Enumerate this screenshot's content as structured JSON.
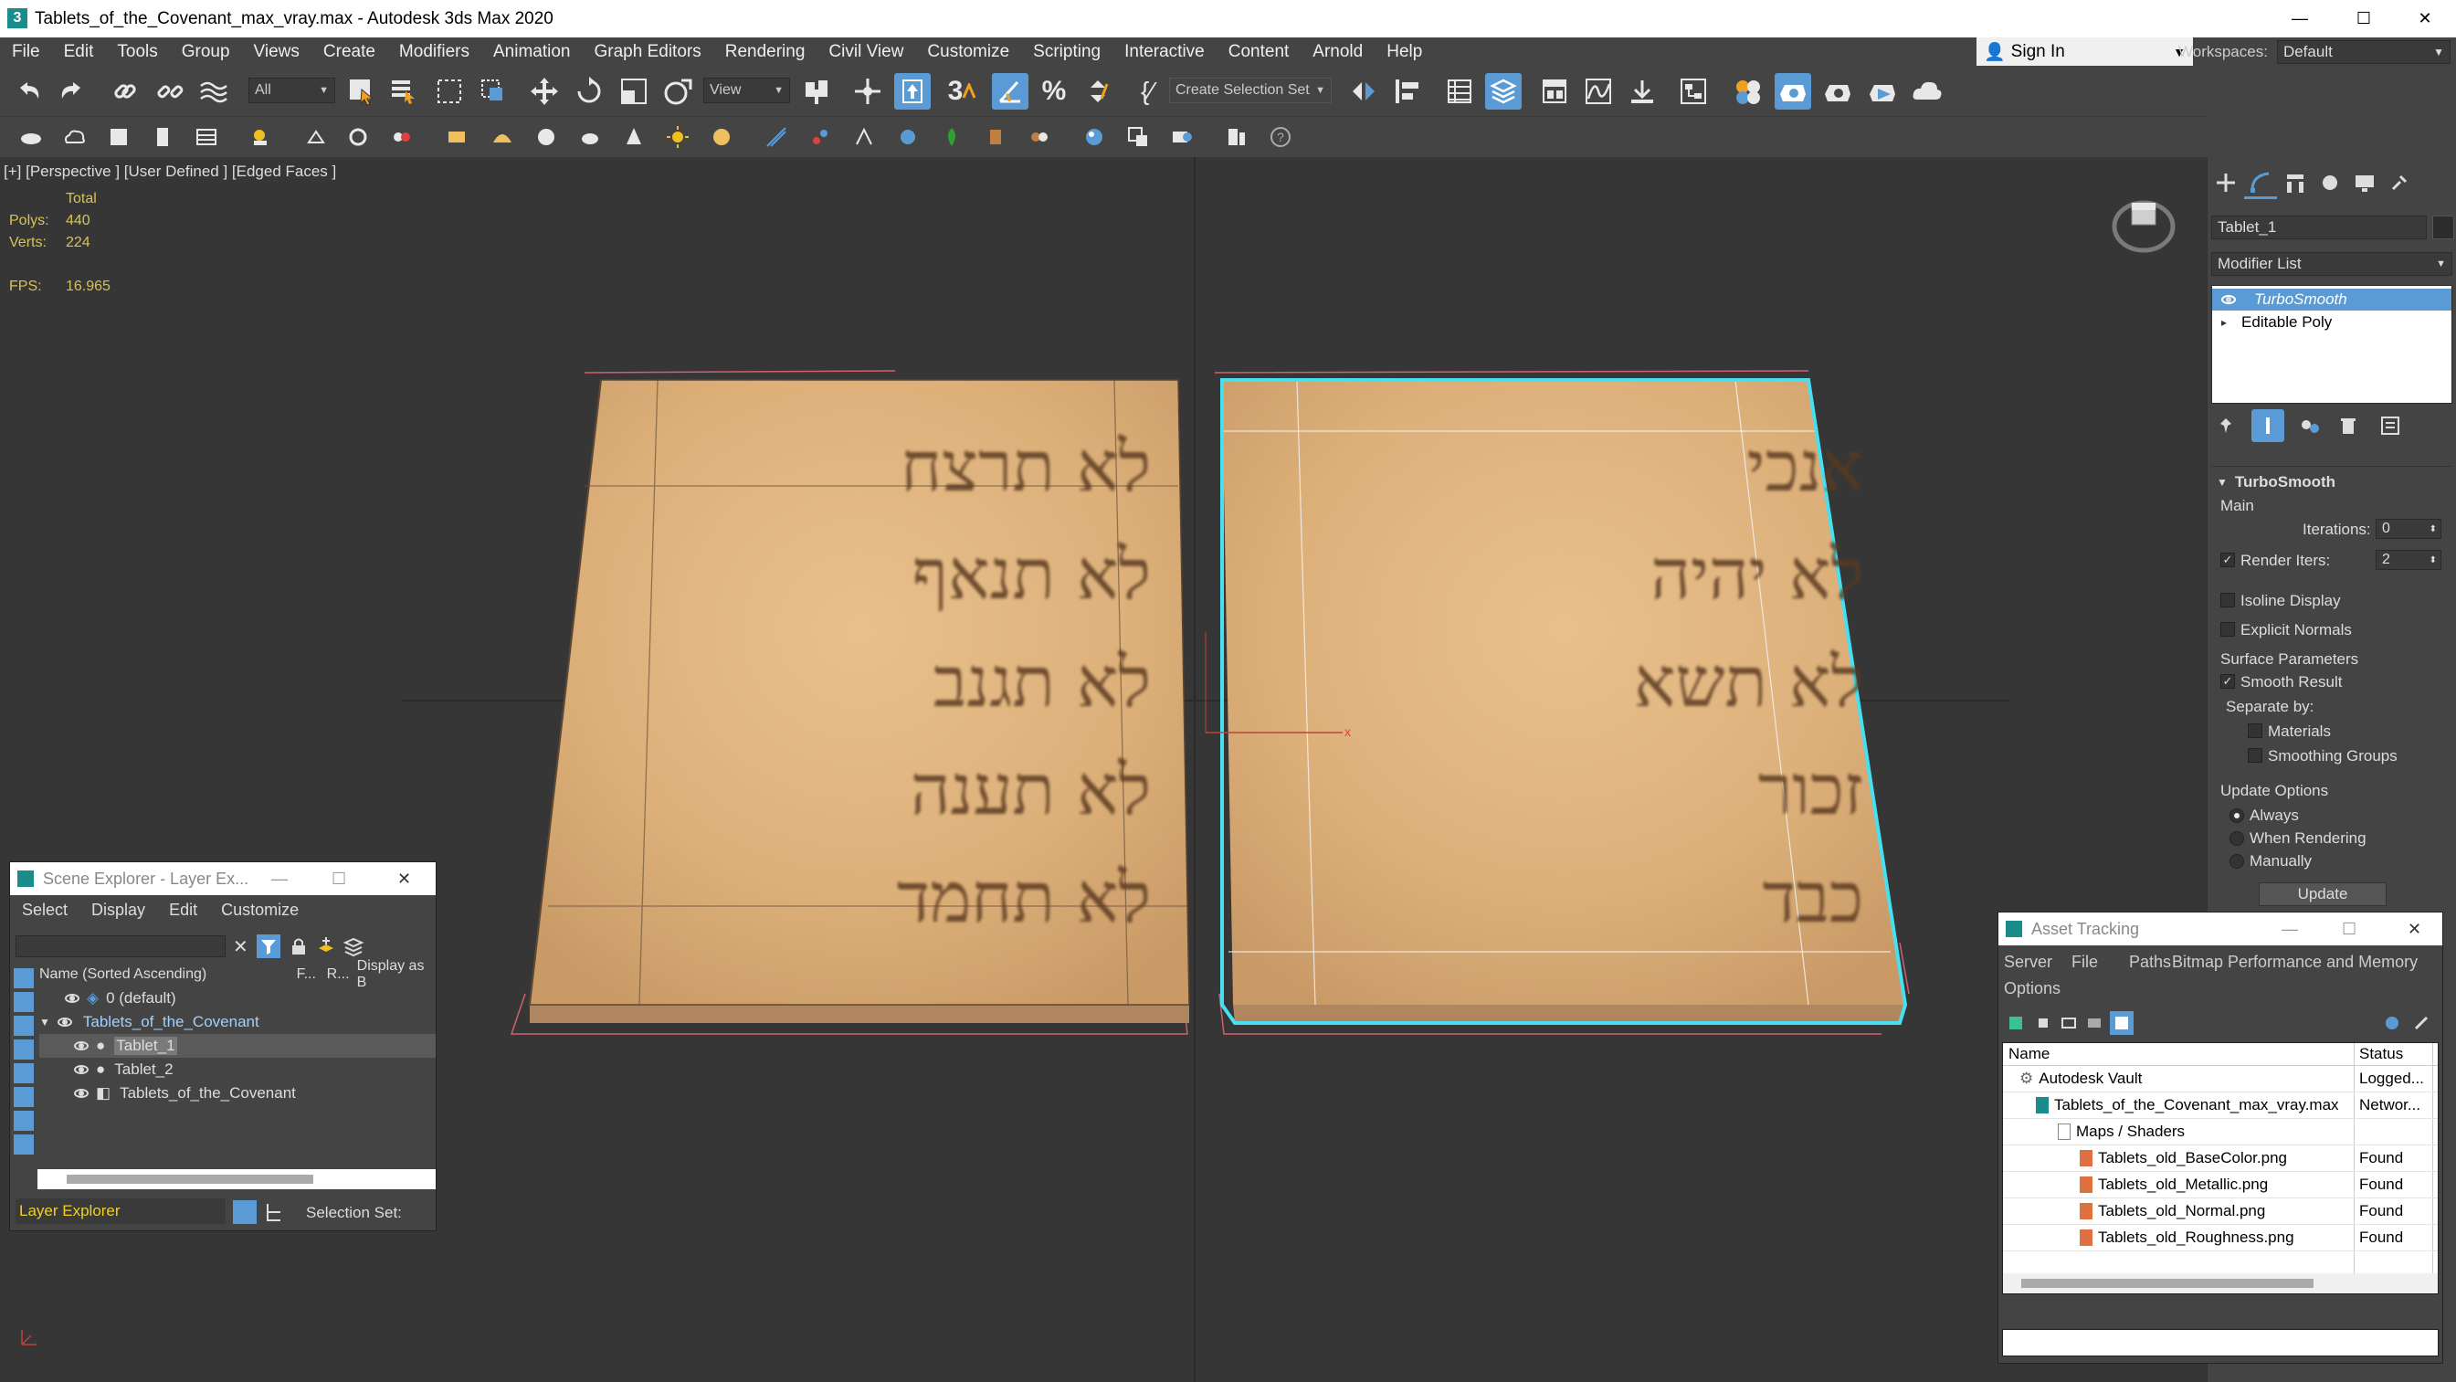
{
  "window": {
    "title": "Tablets_of_the_Covenant_max_vray.max - Autodesk 3ds Max 2020",
    "minimize": "—",
    "maximize": "☐",
    "close": "✕"
  },
  "menu": [
    "File",
    "Edit",
    "Tools",
    "Group",
    "Views",
    "Create",
    "Modifiers",
    "Animation",
    "Graph Editors",
    "Rendering",
    "Civil View",
    "Customize",
    "Scripting",
    "Interactive",
    "Content",
    "Arnold",
    "Help"
  ],
  "account": {
    "sign_in": "Sign In",
    "workspaces_label": "Workspaces:",
    "workspace": "Default"
  },
  "toolbar": {
    "selection_filter": "All",
    "ref_coord": "View",
    "snap_angle_label": "3",
    "named_selection": "Create Selection Set"
  },
  "viewport": {
    "label": "[+] [Perspective ] [User Defined ] [Edged Faces ]",
    "stats_total": "Total",
    "polys_label": "Polys:",
    "polys_value": "440",
    "verts_label": "Verts:",
    "verts_value": "224",
    "fps_label": "FPS:",
    "fps_value": "16.965"
  },
  "tablets": {
    "left_lines": [
      "לא תרצח",
      "לא תנאף",
      "לא תגנב",
      "לא תענה",
      "לא תחמד"
    ],
    "right_lines": [
      "אנכי",
      "לא יהיה",
      "לא תשא",
      "זכור",
      "כבד"
    ]
  },
  "command_panel": {
    "object_name": "Tablet_1",
    "modifier_list": "Modifier List",
    "stack": [
      {
        "label": "TurboSmooth",
        "selected": true
      },
      {
        "label": "Editable Poly",
        "selected": false
      }
    ],
    "rollout_title": "TurboSmooth",
    "main_label": "Main",
    "iterations_label": "Iterations:",
    "iterations_value": "0",
    "render_iters_label": "Render Iters:",
    "render_iters_value": "2",
    "isoline_label": "Isoline Display",
    "explicit_normals_label": "Explicit Normals",
    "surface_params_label": "Surface Parameters",
    "smooth_result_label": "Smooth Result",
    "separate_by_label": "Separate by:",
    "materials_label": "Materials",
    "smoothing_groups_label": "Smoothing Groups",
    "update_options_label": "Update Options",
    "always_label": "Always",
    "when_rendering_label": "When Rendering",
    "manually_label": "Manually",
    "update_button": "Update"
  },
  "scene_explorer": {
    "title": "Scene Explorer - Layer Ex...",
    "menu": [
      "Select",
      "Display",
      "Edit",
      "Customize"
    ],
    "col_name": "Name (Sorted Ascending)",
    "col_f": "F...",
    "col_r": "R...",
    "col_display": "Display as B",
    "rows": [
      "0 (default)",
      "Tablets_of_the_Covenant",
      "Tablet_1",
      "Tablet_2",
      "Tablets_of_the_Covenant"
    ],
    "footer_explorer": "Layer Explorer",
    "footer_selset": "Selection Set:"
  },
  "asset_tracking": {
    "title": "Asset Tracking",
    "menu": [
      "Server",
      "File",
      "Paths",
      "Bitmap Performance and Memory",
      "Options"
    ],
    "col_name": "Name",
    "col_status": "Status",
    "rows": [
      {
        "name": "Autodesk Vault",
        "status": "Logged..."
      },
      {
        "name": "Tablets_of_the_Covenant_max_vray.max",
        "status": "Networ..."
      },
      {
        "name": "Maps / Shaders",
        "status": ""
      },
      {
        "name": "Tablets_old_BaseColor.png",
        "status": "Found"
      },
      {
        "name": "Tablets_old_Metallic.png",
        "status": "Found"
      },
      {
        "name": "Tablets_old_Normal.png",
        "status": "Found"
      },
      {
        "name": "Tablets_old_Roughness.png",
        "status": "Found"
      }
    ]
  },
  "colors": {
    "accent": "#5b9bd5",
    "selection_cyan": "#48e0f0",
    "stats_yellow": "#d8c255",
    "stone": "#e2b985"
  }
}
